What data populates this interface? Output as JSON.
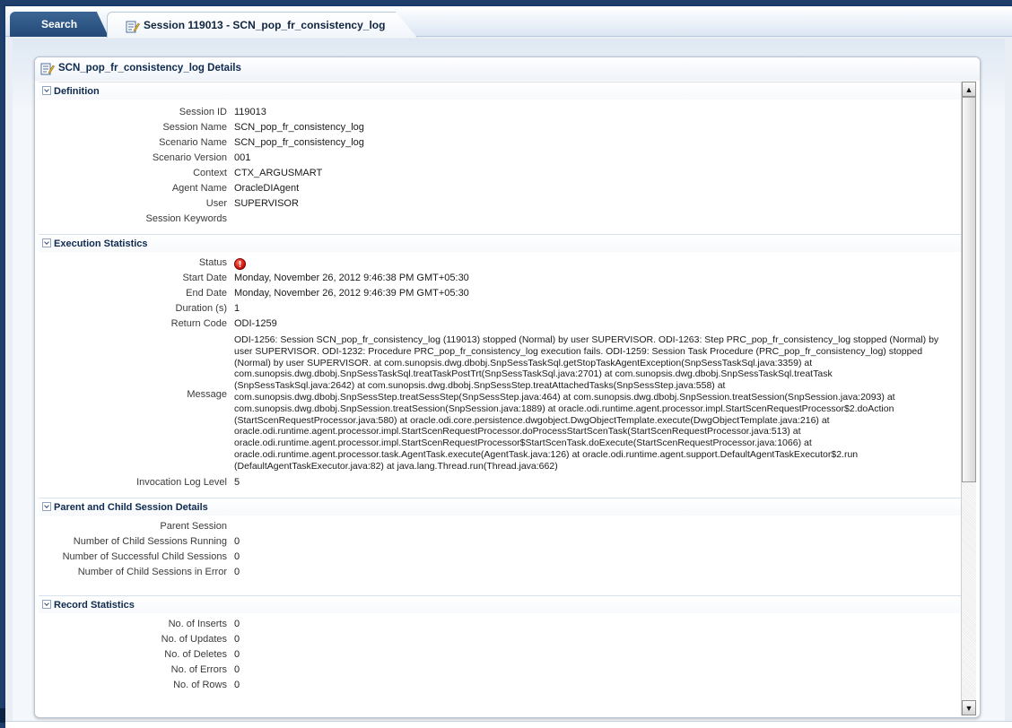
{
  "tabs": {
    "search_label": "Search",
    "session_label": "Session 119013 - SCN_pop_fr_consistency_log"
  },
  "panel": {
    "title": "SCN_pop_fr_consistency_log Details"
  },
  "definition": {
    "heading": "Definition",
    "rows": [
      {
        "label": "Session ID",
        "value": "119013"
      },
      {
        "label": "Session Name",
        "value": "SCN_pop_fr_consistency_log"
      },
      {
        "label": "Scenario Name",
        "value": "SCN_pop_fr_consistency_log"
      },
      {
        "label": "Scenario Version",
        "value": "001"
      },
      {
        "label": "Context",
        "value": "CTX_ARGUSMART"
      },
      {
        "label": "Agent Name",
        "value": "OracleDIAgent"
      },
      {
        "label": "User",
        "value": "SUPERVISOR"
      },
      {
        "label": "Session Keywords",
        "value": ""
      }
    ]
  },
  "execution": {
    "heading": "Execution Statistics",
    "status_label": "Status",
    "status_icon": "error-icon",
    "status_glyph": "!",
    "start_label": "Start Date",
    "start_value": "Monday, November 26, 2012 9:46:38 PM GMT+05:30",
    "end_label": "End Date",
    "end_value": "Monday, November 26, 2012 9:46:39 PM GMT+05:30",
    "duration_label": "Duration (s)",
    "duration_value": "1",
    "return_label": "Return Code",
    "return_value": "ODI-1259",
    "message_label": "Message",
    "message_value": "ODI-1256: Session SCN_pop_fr_consistency_log (119013) stopped (Normal) by user SUPERVISOR. ODI-1263: Step PRC_pop_fr_consistency_log stopped (Normal) by user SUPERVISOR. ODI-1232: Procedure PRC_pop_fr_consistency_log execution fails. ODI-1259: Session Task Procedure (PRC_pop_fr_consistency_log) stopped (Normal) by user SUPERVISOR. at com.sunopsis.dwg.dbobj.SnpSessTaskSql.getStopTaskAgentException(SnpSessTaskSql.java:3359) at com.sunopsis.dwg.dbobj.SnpSessTaskSql.treatTaskPostTrt(SnpSessTaskSql.java:2701) at com.sunopsis.dwg.dbobj.SnpSessTaskSql.treatTask (SnpSessTaskSql.java:2642) at com.sunopsis.dwg.dbobj.SnpSessStep.treatAttachedTasks(SnpSessStep.java:558) at com.sunopsis.dwg.dbobj.SnpSessStep.treatSessStep(SnpSessStep.java:464) at com.sunopsis.dwg.dbobj.SnpSession.treatSession(SnpSession.java:2093) at com.sunopsis.dwg.dbobj.SnpSession.treatSession(SnpSession.java:1889) at oracle.odi.runtime.agent.processor.impl.StartScenRequestProcessor$2.doAction (StartScenRequestProcessor.java:580) at oracle.odi.core.persistence.dwgobject.DwgObjectTemplate.execute(DwgObjectTemplate.java:216) at oracle.odi.runtime.agent.processor.impl.StartScenRequestProcessor.doProcessStartScenTask(StartScenRequestProcessor.java:513) at oracle.odi.runtime.agent.processor.impl.StartScenRequestProcessor$StartScenTask.doExecute(StartScenRequestProcessor.java:1066) at oracle.odi.runtime.agent.processor.task.AgentTask.execute(AgentTask.java:126) at oracle.odi.runtime.agent.support.DefaultAgentTaskExecutor$2.run (DefaultAgentTaskExecutor.java:82) at java.lang.Thread.run(Thread.java:662)",
    "invocation_label": "Invocation Log Level",
    "invocation_value": "5"
  },
  "parent_child": {
    "heading": "Parent and Child Session Details",
    "rows": [
      {
        "label": "Parent Session",
        "value": ""
      },
      {
        "label": "Number of Child Sessions Running",
        "value": "0"
      },
      {
        "label": "Number of Successful Child Sessions",
        "value": "0"
      },
      {
        "label": "Number of Child Sessions in Error",
        "value": "0"
      }
    ]
  },
  "records": {
    "heading": "Record Statistics",
    "rows": [
      {
        "label": "No. of Inserts",
        "value": "0"
      },
      {
        "label": "No. of Updates",
        "value": "0"
      },
      {
        "label": "No. of Deletes",
        "value": "0"
      },
      {
        "label": "No. of Errors",
        "value": "0"
      },
      {
        "label": "No. of Rows",
        "value": "0"
      }
    ]
  },
  "icons": {
    "tab_icon": "edit-document-icon",
    "panel_icon": "edit-document-icon",
    "scroll_up": "▲",
    "scroll_down": "▼"
  },
  "colors": {
    "tab_active_bg": "#ffffff",
    "tab_inactive_bg": "#2f5785",
    "heading_text": "#0e2a4f",
    "status_error": "#d1140f"
  }
}
